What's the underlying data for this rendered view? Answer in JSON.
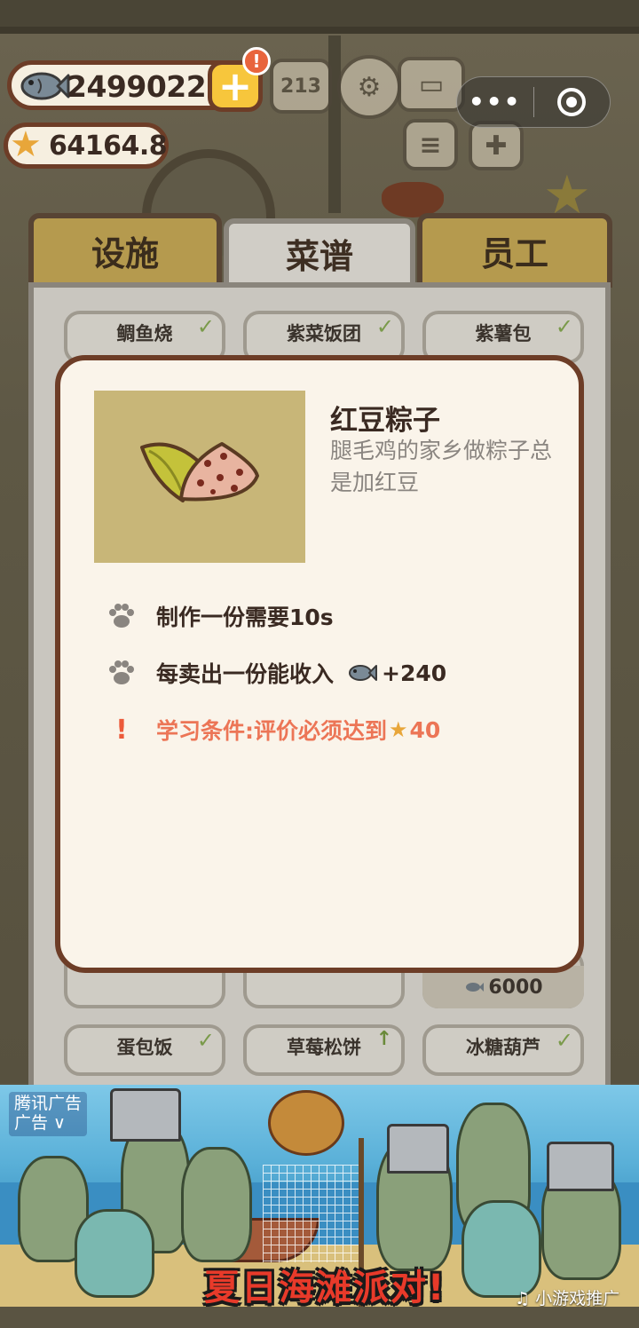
{
  "hud": {
    "fish_count": "24990227",
    "plus_label": "+",
    "alert_label": "!",
    "star_score": "64164.8",
    "ranking_label": "213"
  },
  "capsule": {
    "more_label": "•••"
  },
  "tabs": [
    {
      "label": "设施",
      "active": false
    },
    {
      "label": "菜谱",
      "active": true
    },
    {
      "label": "员工",
      "active": false
    }
  ],
  "recipes_top": [
    {
      "name": "鲷鱼烧",
      "learned": true
    },
    {
      "name": "紫菜饭团",
      "learned": true
    },
    {
      "name": "紫薯包",
      "learned": true
    }
  ],
  "recipes_bottom": [
    {
      "name": "蛋包饭",
      "status": "learned"
    },
    {
      "name": "草莓松饼",
      "status": "upgrade"
    },
    {
      "name": "冰糖葫芦",
      "status": "learned"
    }
  ],
  "hidden_card_price": "6000",
  "modal": {
    "dish_name": "红豆粽子",
    "description": "腿毛鸡的家乡做粽子总是加红豆",
    "time_text": "制作一份需要10s",
    "income_label": "每卖出一份能收入",
    "income_value": "+240",
    "requirement_label": "学习条件:评价必须达到",
    "requirement_value": "40"
  },
  "ad": {
    "label_line1": "腾讯广告",
    "label_line2": "广告 ∨",
    "title": "夏日海滩派对!",
    "source": "♫ 小游戏推广"
  },
  "colors": {
    "accent_brown": "#6d3d27",
    "warning": "#ec7556",
    "gold": "#f7c63c",
    "tab_gold": "#b59a4e"
  }
}
